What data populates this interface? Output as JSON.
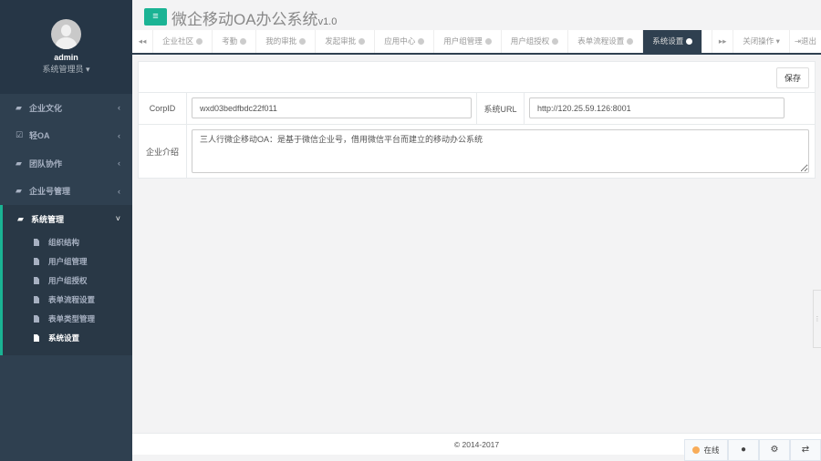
{
  "profile": {
    "name": "admin",
    "role": "系统管理员"
  },
  "sidebar": {
    "items": [
      {
        "label": "企业文化"
      },
      {
        "label": "轻OA"
      },
      {
        "label": "团队协作"
      },
      {
        "label": "企业号管理"
      },
      {
        "label": "系统管理"
      }
    ],
    "sub_items": [
      {
        "label": "组织结构"
      },
      {
        "label": "用户组管理"
      },
      {
        "label": "用户组授权"
      },
      {
        "label": "表单流程设置"
      },
      {
        "label": "表单类型管理"
      },
      {
        "label": "系统设置"
      }
    ]
  },
  "header": {
    "title": "微企移动OA办公系统",
    "version": "v1.0"
  },
  "tabs": [
    {
      "label": "企业社区"
    },
    {
      "label": "考勤"
    },
    {
      "label": "我的审批"
    },
    {
      "label": "发起审批"
    },
    {
      "label": "应用中心"
    },
    {
      "label": "用户组管理"
    },
    {
      "label": "用户组授权"
    },
    {
      "label": "表单流程设置"
    },
    {
      "label": "系统设置"
    }
  ],
  "tab_actions": {
    "close_ops": "关闭操作",
    "logout": "退出"
  },
  "form": {
    "save_label": "保存",
    "corpid_label": "CorpID",
    "corpid_value": "wxd03bedfbdc22f011",
    "url_label": "系统URL",
    "url_value": "http://120.25.59.126:8001",
    "intro_label": "企业介绍",
    "intro_value": "三人行微企移动OA：是基于微信企业号，借用微信平台而建立的移动办公系统"
  },
  "footer": {
    "copyright": "© 2014-2017"
  },
  "status": {
    "online_label": "在线"
  },
  "colors": {
    "accent": "#1ab394",
    "sidebar": "#2f4050",
    "online": "#f8ac59"
  }
}
